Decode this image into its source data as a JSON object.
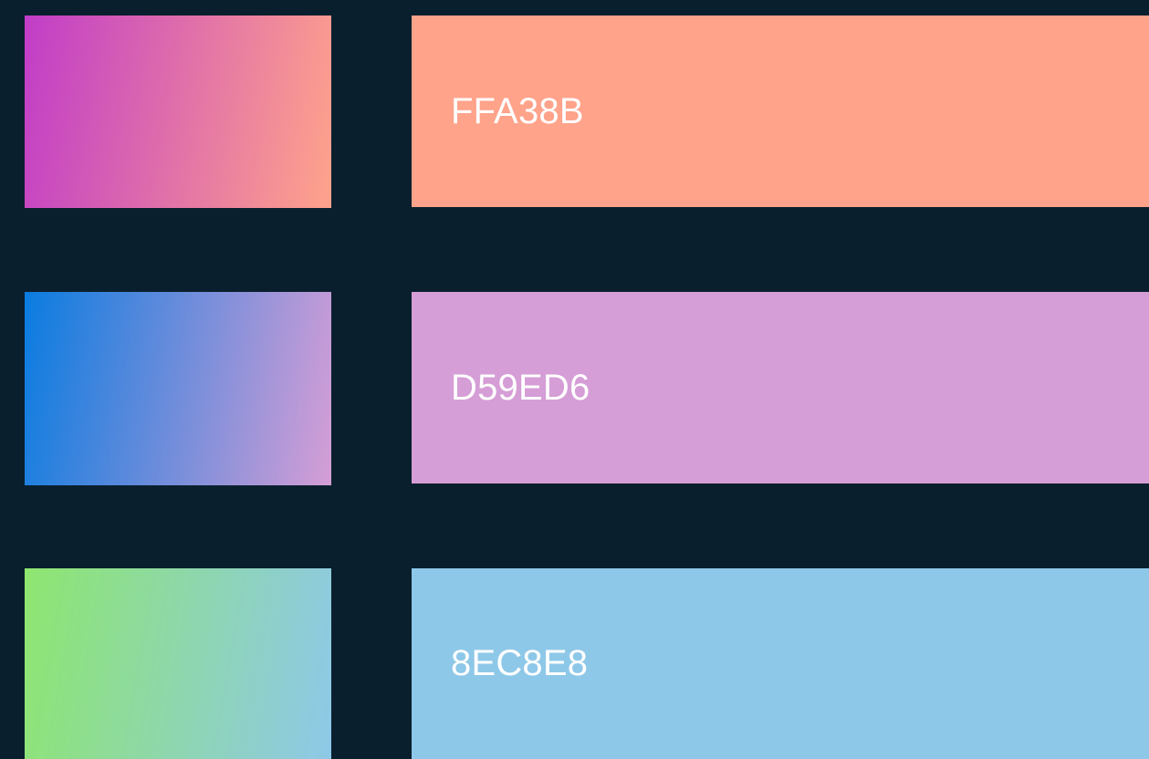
{
  "palette": {
    "background_color": "#0a1f2d",
    "rows": [
      {
        "hex_label": "FFA38B",
        "bar_color": "#FFA38B",
        "gradient_start": "#C13DC8",
        "gradient_end": "#FFA38B"
      },
      {
        "hex_label": "D59ED6",
        "bar_color": "#D59ED6",
        "gradient_start": "#0A7CE0",
        "gradient_end": "#D59ED6"
      },
      {
        "hex_label": "8EC8E8",
        "bar_color": "#8EC8E8",
        "gradient_start": "#8EE66F",
        "gradient_end": "#8EC8E8"
      }
    ]
  }
}
